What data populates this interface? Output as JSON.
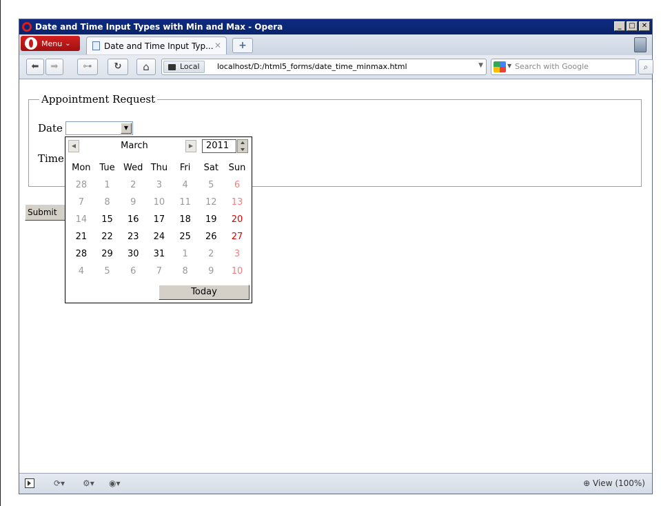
{
  "window": {
    "title": "Date and Time Input Types with Min and Max - Opera",
    "controls": {
      "minimize": "_",
      "maximize": "□",
      "close": "✕"
    }
  },
  "tabbar": {
    "menu_label": "Menu",
    "menu_arrow": "⌄",
    "tab_title": "Date and Time Input Typ...",
    "tab_close": "✕",
    "new_tab": "+"
  },
  "toolbar": {
    "back": "⬅",
    "forward": "➡",
    "key": "⊶",
    "reload": "↻",
    "home": "⌂",
    "local_label": "Local",
    "url": "localhost/D:/html5_forms/date_time_minmax.html",
    "url_drop": "▼",
    "search_drop": "▼",
    "search_placeholder": "Search with Google",
    "search_go": "⌕"
  },
  "form": {
    "legend": "Appointment Request",
    "date_label": "Date",
    "time_label": "Time",
    "date_value": "",
    "select_arrow": "▼",
    "submit_label": "Submit"
  },
  "calendar": {
    "month": "March",
    "year": "2011",
    "prev": "◀",
    "next": "▶",
    "weekdays": [
      "Mon",
      "Tue",
      "Wed",
      "Thu",
      "Fri",
      "Sat",
      "Sun"
    ],
    "weeks": [
      [
        "28",
        "1",
        "2",
        "3",
        "4",
        "5",
        "6"
      ],
      [
        "7",
        "8",
        "9",
        "10",
        "11",
        "12",
        "13"
      ],
      [
        "14",
        "15",
        "16",
        "17",
        "18",
        "19",
        "20"
      ],
      [
        "21",
        "22",
        "23",
        "24",
        "25",
        "26",
        "27"
      ],
      [
        "28",
        "29",
        "30",
        "31",
        "1",
        "2",
        "3"
      ],
      [
        "4",
        "5",
        "6",
        "7",
        "8",
        "9",
        "10"
      ]
    ],
    "today_label": "Today"
  },
  "statusbar": {
    "zoom_label": "View (100%)",
    "zoom_icon": "⊕",
    "sync_icon": "⟳▾",
    "unite_icon": "⚙▾",
    "turbo_icon": "◉▾"
  }
}
